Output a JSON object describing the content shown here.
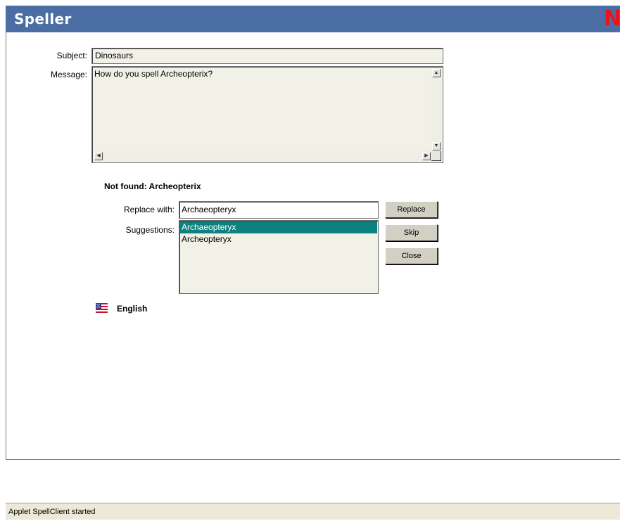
{
  "window": {
    "title": "Speller",
    "logo": "N"
  },
  "form": {
    "subject_label": "Subject:",
    "subject_value": "Dinosaurs",
    "message_label": "Message:",
    "message_value": "How do you spell Archeopterix?"
  },
  "speller": {
    "not_found": "Not found: Archeopterix",
    "replace_label": "Replace with:",
    "replace_value": "Archaeopteryx",
    "suggestions_label": "Suggestions:",
    "suggestions": [
      "Archaeopteryx",
      "Archeopteryx"
    ],
    "selected_index": 0,
    "buttons": {
      "replace": "Replace",
      "skip": "Skip",
      "close": "Close"
    },
    "language": "English",
    "language_icon": "us-flag-icon"
  },
  "status": {
    "text": "Applet SpellClient started"
  },
  "colors": {
    "title_bg": "#4a6ea4",
    "logo": "#e8141b",
    "selection": "#0d8080",
    "button": "#d2cfc3"
  }
}
